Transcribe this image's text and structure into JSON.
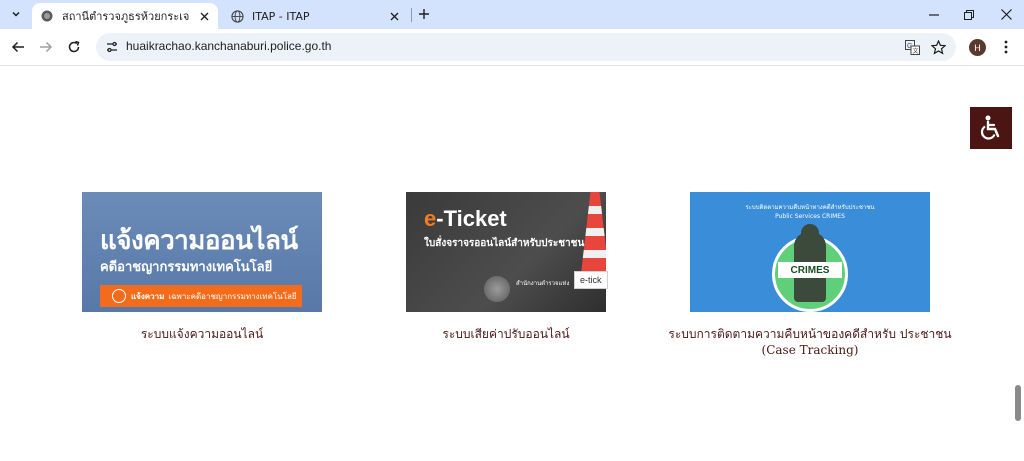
{
  "browser": {
    "tabs": [
      {
        "title": "สถานีตำรวจภูธรห้วยกระเจา – สภ.ห้วยกระเจา",
        "active": true
      },
      {
        "title": "ITAP - ITAP",
        "active": false
      }
    ],
    "url": "huaikrachao.kanchanaburi.police.go.th",
    "avatar_initial": "H"
  },
  "page": {
    "cards": [
      {
        "caption": "ระบบแจ้งความออนไลน์",
        "banner": {
          "headline": "แจ้งความออนไลน์",
          "subline": "คดีอาชญากรรมทางเทคโนโลยี",
          "button": "แจ้งความ",
          "button_rest": "เฉพาะคดีอาชญากรรมทางเทคโนโลยี"
        }
      },
      {
        "caption": "ระบบเสียค่าปรับออนไลน์",
        "banner": {
          "headline_e": "e",
          "headline_rest": "-Ticket",
          "subline": "ใบสั่งจราจรออนไลน์สำหรับประชาชน",
          "org": "สำนักงานตำรวจแห่ง"
        }
      },
      {
        "caption": "ระบบการติดตามความคืบหน้าของคดีสำหรับ ประชาชน (Case Tracking)",
        "banner": {
          "line1": "ระบบติดตามความคืบหน้าทางคดีสำหรับประชาชน",
          "line2": "Public Services CRIMES",
          "badge": "CRIMES"
        }
      }
    ],
    "tooltip": "e-tick"
  },
  "colors": {
    "tabstrip": "#d3e3fd",
    "caption_text": "#4a1a17",
    "a11y_button": "#4a1512"
  }
}
